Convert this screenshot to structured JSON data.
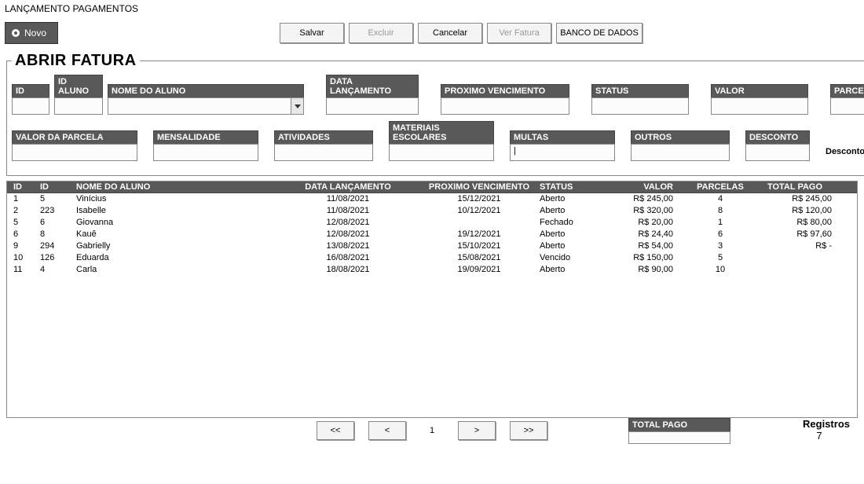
{
  "window_title": "LANÇAMENTO PAGAMENTOS",
  "toolbar": {
    "novo": "Novo",
    "salvar": "Salvar",
    "excluir": "Excluir",
    "cancelar": "Cancelar",
    "ver_fatura": "Ver Fatura",
    "banco_dados": "BANCO DE DADOS"
  },
  "form": {
    "legend": "ABRIR FATURA",
    "labels": {
      "id": "ID",
      "id_aluno": "ID ALUNO",
      "nome_aluno": "NOME DO ALUNO",
      "data_lanc": "DATA LANÇAMENTO",
      "prox_venc": "PROXIMO VENCIMENTO",
      "status": "STATUS",
      "valor": "VALOR",
      "parcelas": "PARCELAS",
      "valor_parcela": "VALOR DA PARCELA",
      "mensalidade": "MENSALIDADE",
      "atividades": "ATIVIDADES",
      "materiais": "MATERIAIS ESCOLARES",
      "multas": "MULTAS",
      "outros": "OUTROS",
      "desconto": "DESCONTO",
      "desconto_pct": "Desconto %"
    },
    "values": {
      "id": "",
      "id_aluno": "",
      "nome_aluno": "",
      "data_lanc": "",
      "prox_venc": "",
      "status": "",
      "valor": "",
      "parcelas": "",
      "valor_parcela": "",
      "mensalidade": "",
      "atividades": "",
      "materiais": "",
      "multas": "",
      "outros": "",
      "desconto": ""
    }
  },
  "grid": {
    "headers": {
      "id1": "ID",
      "id2": "ID",
      "nome": "NOME DO ALUNO",
      "data": "DATA LANÇAMENTO",
      "prox": "PROXIMO VENCIMENTO",
      "status": "STATUS",
      "valor": "VALOR",
      "parcelas": "PARCELAS",
      "total": "TOTAL PAGO"
    },
    "rows": [
      {
        "id1": "1",
        "id2": "5",
        "nome": "Vinícius",
        "data": "11/08/2021",
        "prox": "15/12/2021",
        "status": "Aberto",
        "valor": "R$ 245,00",
        "parc": "4",
        "total": "R$ 245,00"
      },
      {
        "id1": "2",
        "id2": "223",
        "nome": "Isabelle",
        "data": "11/08/2021",
        "prox": "10/12/2021",
        "status": "Aberto",
        "valor": "R$ 320,00",
        "parc": "8",
        "total": "R$ 120,00"
      },
      {
        "id1": "5",
        "id2": "6",
        "nome": "Giovanna",
        "data": "12/08/2021",
        "prox": "",
        "status": "Fechado",
        "valor": "R$ 20,00",
        "parc": "1",
        "total": "R$ 80,00"
      },
      {
        "id1": "6",
        "id2": "8",
        "nome": "Kauê",
        "data": "12/08/2021",
        "prox": "19/12/2021",
        "status": "Aberto",
        "valor": "R$ 24,40",
        "parc": "6",
        "total": "R$ 97,60"
      },
      {
        "id1": "9",
        "id2": "294",
        "nome": "Gabrielly",
        "data": "13/08/2021",
        "prox": "15/10/2021",
        "status": "Aberto",
        "valor": "R$ 54,00",
        "parc": "3",
        "total": "R$ -"
      },
      {
        "id1": "10",
        "id2": "126",
        "nome": "Eduarda",
        "data": "16/08/2021",
        "prox": "15/08/2021",
        "status": "Vencido",
        "valor": "R$ 150,00",
        "parc": "5",
        "total": ""
      },
      {
        "id1": "11",
        "id2": "4",
        "nome": "Carla",
        "data": "18/08/2021",
        "prox": "19/09/2021",
        "status": "Aberto",
        "valor": "R$ 90,00",
        "parc": "10",
        "total": ""
      }
    ]
  },
  "pager": {
    "first": "<<",
    "prev": "<",
    "page": "1",
    "next": ">",
    "last": ">>"
  },
  "footer": {
    "total_pago_label": "TOTAL PAGO",
    "total_pago_value": "",
    "registros_label": "Registros",
    "registros_value": "7"
  }
}
